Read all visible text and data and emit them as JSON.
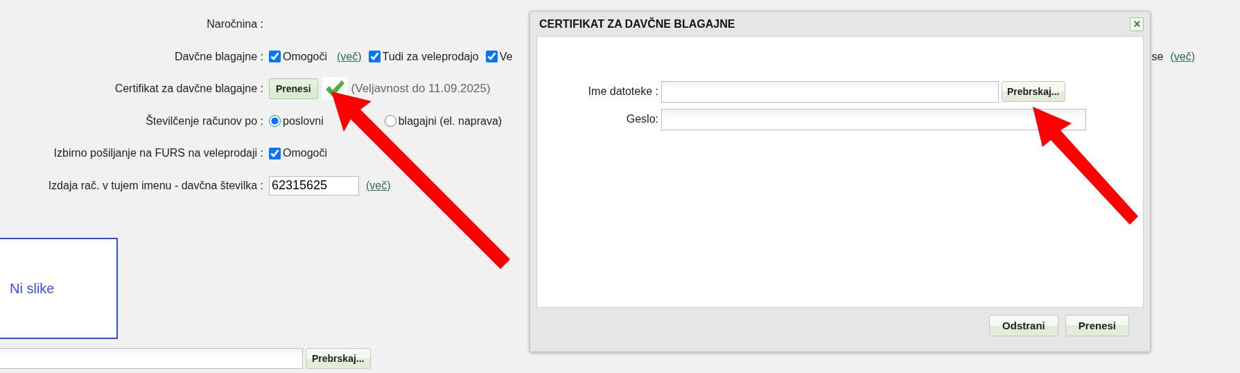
{
  "form": {
    "rows": [
      {
        "label": "Naročnina :",
        "kind": "empty"
      },
      {
        "label": "Davčne blagajne :",
        "kind": "checks",
        "items": [
          {
            "kind": "checkbox",
            "label": "Omogoči",
            "checked": true
          },
          {
            "kind": "link",
            "text": "(več)"
          },
          {
            "kind": "checkbox",
            "label": "Tudi za veleprodajo",
            "checked": true
          },
          {
            "kind": "checkbox",
            "label": "Ve",
            "checked": true
          }
        ],
        "tail": [
          {
            "kind": "text",
            "text": "se"
          },
          {
            "kind": "link",
            "text": "(več)"
          }
        ]
      },
      {
        "label": "Certifikat za davčne blagajne :",
        "kind": "upload",
        "button": "Prenesi",
        "valid": true,
        "note": "(Veljavnost do 11.09.2025)"
      },
      {
        "label": "Številčenje računov po :",
        "kind": "radios",
        "items": [
          {
            "label": "poslovni",
            "selected": true
          },
          {
            "label": "blagajni (el. naprava)",
            "selected": false
          }
        ]
      },
      {
        "label": "Izbirno pošiljanje na FURS na veleprodaji :",
        "kind": "checks",
        "items": [
          {
            "kind": "checkbox",
            "label": "Omogoči",
            "checked": true
          }
        ]
      },
      {
        "label": "Izdaja rač. v tujem imenu - davčna številka :",
        "kind": "input",
        "value": "62315625",
        "link": "(več)"
      }
    ]
  },
  "image": {
    "text": "Ni slike"
  },
  "file": {
    "button": "Prebrskaj..."
  },
  "dialog": {
    "title": "CERTIFIKAT ZA DAVČNE BLAGAJNE",
    "fields": [
      {
        "label": "Ime datoteke :",
        "kind": "file",
        "button": "Prebrskaj..."
      },
      {
        "label": "Geslo:",
        "kind": "password"
      }
    ],
    "buttons": [
      "Odstrani",
      "Prenesi"
    ]
  }
}
